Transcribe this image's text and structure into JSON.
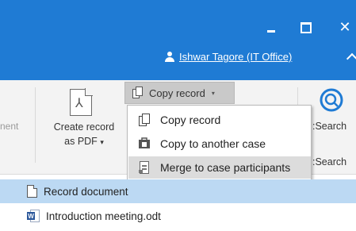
{
  "titlebar": {
    "minimize_icon": "minimize-icon",
    "maximize_icon": "maximize-icon",
    "close_glyph": "✕",
    "user_label": "Ishwar Tagore (IT Office)",
    "accent_color": "#1f7bd4"
  },
  "ribbon": {
    "partial_left_label": "nent",
    "create_pdf": {
      "line1": "Create record",
      "line2": "as PDF",
      "arrow": "▾",
      "icon": "pdf-document-icon"
    },
    "copy_record_button": {
      "label": "Copy record",
      "arrow": "▾",
      "icon": "copy-icon"
    },
    "right_partial": {
      "label1": ":Search",
      "label2": ":Search",
      "icon": "search-icon"
    }
  },
  "copy_menu": {
    "items": [
      {
        "label": "Copy record",
        "icon": "copy-icon"
      },
      {
        "label": "Copy to another case",
        "icon": "copy-to-case-icon"
      },
      {
        "label": "Merge to case participants",
        "icon": "merge-icon",
        "highlighted": true
      }
    ]
  },
  "documents": [
    {
      "label": "Record document",
      "icon": "document-icon",
      "selected": true
    },
    {
      "label": "Introduction meeting.odt",
      "icon": "word-document-icon",
      "selected": false
    }
  ]
}
